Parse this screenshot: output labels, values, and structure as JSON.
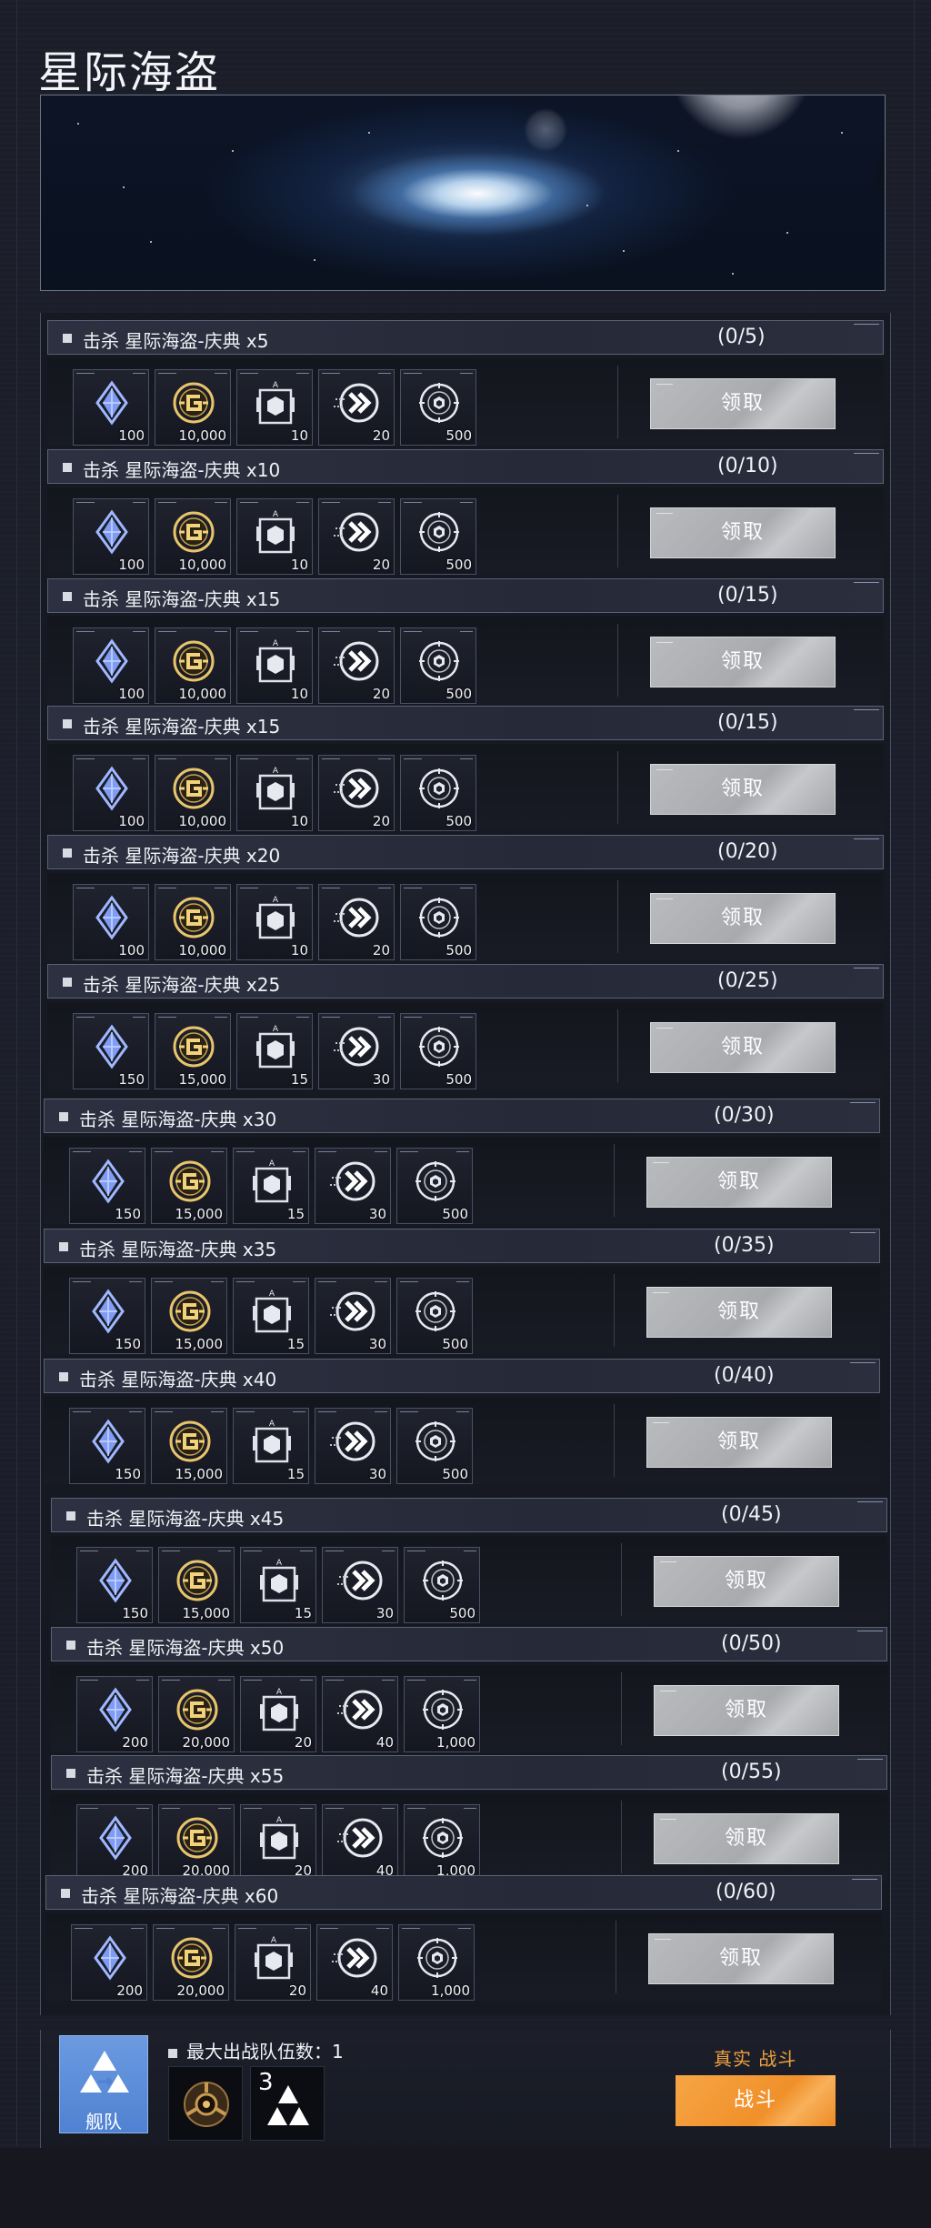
{
  "page": {
    "title": "星际海盗"
  },
  "colors": {
    "accent": "#f0902a",
    "claim_disabled": "#b0b2b6",
    "fleet": "#5b8ad6",
    "real_battle": "#f0a040"
  },
  "tasks": [
    {
      "name": "击杀 星际海盗-庆典 x5",
      "progress": "(0/5)",
      "claim_label": "领取",
      "rewards": [
        {
          "icon": "crystal-icon",
          "qty": "100"
        },
        {
          "icon": "gold-coin-icon",
          "qty": "10,000"
        },
        {
          "icon": "hex-crate-icon",
          "qty": "10"
        },
        {
          "icon": "speed-arrows-icon",
          "qty": "20"
        },
        {
          "icon": "core-compass-icon",
          "qty": "500"
        }
      ]
    },
    {
      "name": "击杀 星际海盗-庆典 x10",
      "progress": "(0/10)",
      "claim_label": "领取",
      "rewards": [
        {
          "icon": "crystal-icon",
          "qty": "100"
        },
        {
          "icon": "gold-coin-icon",
          "qty": "10,000"
        },
        {
          "icon": "hex-crate-icon",
          "qty": "10"
        },
        {
          "icon": "speed-arrows-icon",
          "qty": "20"
        },
        {
          "icon": "core-compass-icon",
          "qty": "500"
        }
      ]
    },
    {
      "name": "击杀 星际海盗-庆典 x15",
      "progress": "(0/15)",
      "claim_label": "领取",
      "rewards": [
        {
          "icon": "crystal-icon",
          "qty": "100"
        },
        {
          "icon": "gold-coin-icon",
          "qty": "10,000"
        },
        {
          "icon": "hex-crate-icon",
          "qty": "10"
        },
        {
          "icon": "speed-arrows-icon",
          "qty": "20"
        },
        {
          "icon": "core-compass-icon",
          "qty": "500"
        }
      ]
    },
    {
      "name": "击杀 星际海盗-庆典 x15",
      "progress": "(0/15)",
      "claim_label": "领取",
      "rewards": [
        {
          "icon": "crystal-icon",
          "qty": "100"
        },
        {
          "icon": "gold-coin-icon",
          "qty": "10,000"
        },
        {
          "icon": "hex-crate-icon",
          "qty": "10"
        },
        {
          "icon": "speed-arrows-icon",
          "qty": "20"
        },
        {
          "icon": "core-compass-icon",
          "qty": "500"
        }
      ]
    },
    {
      "name": "击杀 星际海盗-庆典 x20",
      "progress": "(0/20)",
      "claim_label": "领取",
      "rewards": [
        {
          "icon": "crystal-icon",
          "qty": "100"
        },
        {
          "icon": "gold-coin-icon",
          "qty": "10,000"
        },
        {
          "icon": "hex-crate-icon",
          "qty": "10"
        },
        {
          "icon": "speed-arrows-icon",
          "qty": "20"
        },
        {
          "icon": "core-compass-icon",
          "qty": "500"
        }
      ]
    },
    {
      "name": "击杀 星际海盗-庆典 x25",
      "progress": "(0/25)",
      "claim_label": "领取",
      "rewards": [
        {
          "icon": "crystal-icon",
          "qty": "150"
        },
        {
          "icon": "gold-coin-icon",
          "qty": "15,000"
        },
        {
          "icon": "hex-crate-icon",
          "qty": "15"
        },
        {
          "icon": "speed-arrows-icon",
          "qty": "30"
        },
        {
          "icon": "core-compass-icon",
          "qty": "500"
        }
      ]
    },
    {
      "name": "击杀 星际海盗-庆典 x30",
      "progress": "(0/30)",
      "claim_label": "领取",
      "rewards": [
        {
          "icon": "crystal-icon",
          "qty": "150"
        },
        {
          "icon": "gold-coin-icon",
          "qty": "15,000"
        },
        {
          "icon": "hex-crate-icon",
          "qty": "15"
        },
        {
          "icon": "speed-arrows-icon",
          "qty": "30"
        },
        {
          "icon": "core-compass-icon",
          "qty": "500"
        }
      ]
    },
    {
      "name": "击杀 星际海盗-庆典 x35",
      "progress": "(0/35)",
      "claim_label": "领取",
      "rewards": [
        {
          "icon": "crystal-icon",
          "qty": "150"
        },
        {
          "icon": "gold-coin-icon",
          "qty": "15,000"
        },
        {
          "icon": "hex-crate-icon",
          "qty": "15"
        },
        {
          "icon": "speed-arrows-icon",
          "qty": "30"
        },
        {
          "icon": "core-compass-icon",
          "qty": "500"
        }
      ]
    },
    {
      "name": "击杀 星际海盗-庆典 x40",
      "progress": "(0/40)",
      "claim_label": "领取",
      "rewards": [
        {
          "icon": "crystal-icon",
          "qty": "150"
        },
        {
          "icon": "gold-coin-icon",
          "qty": "15,000"
        },
        {
          "icon": "hex-crate-icon",
          "qty": "15"
        },
        {
          "icon": "speed-arrows-icon",
          "qty": "30"
        },
        {
          "icon": "core-compass-icon",
          "qty": "500"
        }
      ]
    },
    {
      "name": "击杀 星际海盗-庆典 x45",
      "progress": "(0/45)",
      "claim_label": "领取",
      "rewards": [
        {
          "icon": "crystal-icon",
          "qty": "150"
        },
        {
          "icon": "gold-coin-icon",
          "qty": "15,000"
        },
        {
          "icon": "hex-crate-icon",
          "qty": "15"
        },
        {
          "icon": "speed-arrows-icon",
          "qty": "30"
        },
        {
          "icon": "core-compass-icon",
          "qty": "500"
        }
      ]
    },
    {
      "name": "击杀 星际海盗-庆典 x50",
      "progress": "(0/50)",
      "claim_label": "领取",
      "rewards": [
        {
          "icon": "crystal-icon",
          "qty": "200"
        },
        {
          "icon": "gold-coin-icon",
          "qty": "20,000"
        },
        {
          "icon": "hex-crate-icon",
          "qty": "20"
        },
        {
          "icon": "speed-arrows-icon",
          "qty": "40"
        },
        {
          "icon": "core-compass-icon",
          "qty": "1,000"
        }
      ]
    },
    {
      "name": "击杀 星际海盗-庆典 x55",
      "progress": "(0/55)",
      "claim_label": "领取",
      "rewards": [
        {
          "icon": "crystal-icon",
          "qty": "200"
        },
        {
          "icon": "gold-coin-icon",
          "qty": "20,000"
        },
        {
          "icon": "hex-crate-icon",
          "qty": "20"
        },
        {
          "icon": "speed-arrows-icon",
          "qty": "40"
        },
        {
          "icon": "core-compass-icon",
          "qty": "1,000"
        }
      ]
    },
    {
      "name": "击杀 星际海盗-庆典 x60",
      "progress": "(0/60)",
      "claim_label": "领取",
      "rewards": [
        {
          "icon": "crystal-icon",
          "qty": "200"
        },
        {
          "icon": "gold-coin-icon",
          "qty": "20,000"
        },
        {
          "icon": "hex-crate-icon",
          "qty": "20"
        },
        {
          "icon": "speed-arrows-icon",
          "qty": "40"
        },
        {
          "icon": "core-compass-icon",
          "qty": "1,000"
        }
      ]
    }
  ],
  "bottom": {
    "fleet_label": "舰队",
    "max_teams_label": "最大出战队伍数：1",
    "slot_count": "3",
    "real_battle_label": "真实 战斗",
    "battle_label": "战斗"
  }
}
